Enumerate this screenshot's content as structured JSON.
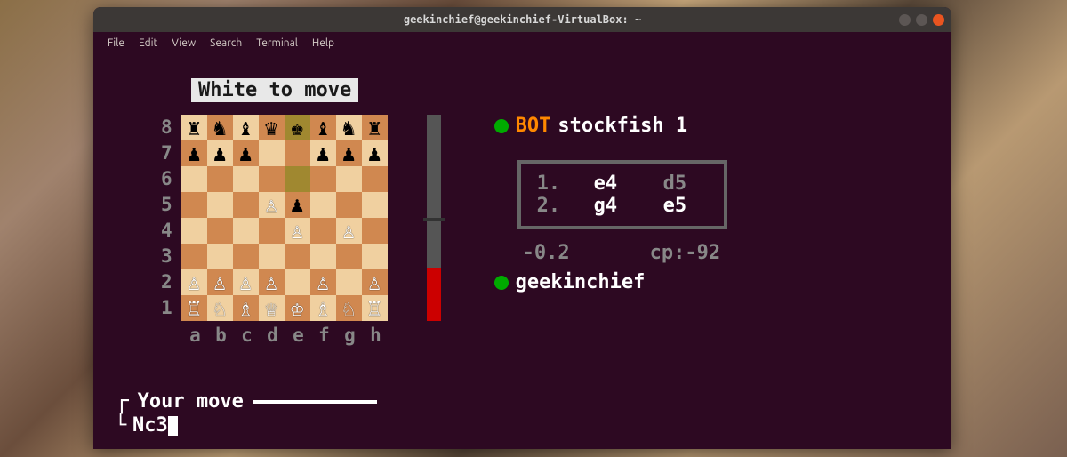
{
  "window": {
    "title": "geekinchief@geekinchief-VirtualBox: ~"
  },
  "menubar": [
    "File",
    "Edit",
    "View",
    "Search",
    "Terminal",
    "Help"
  ],
  "game": {
    "status": "White to move",
    "ranks": [
      "8",
      "7",
      "6",
      "5",
      "4",
      "3",
      "2",
      "1"
    ],
    "files": [
      "a",
      "b",
      "c",
      "d",
      "e",
      "f",
      "g",
      "h"
    ],
    "board": [
      [
        "r",
        "n",
        "b",
        "q",
        "k",
        "b",
        "n",
        "r"
      ],
      [
        "P",
        "P",
        "P",
        "",
        "",
        "P",
        "P",
        "P"
      ],
      [
        "",
        "",
        "",
        "",
        "",
        "",
        "",
        ""
      ],
      [
        "",
        "",
        "",
        "P",
        "p",
        "",
        "",
        ""
      ],
      [
        "",
        "",
        "",
        "",
        "P",
        "",
        "P",
        ""
      ],
      [
        "",
        "",
        "",
        "",
        "",
        "",
        "",
        ""
      ],
      [
        "P",
        "P",
        "P",
        "P",
        "",
        "P",
        "",
        "P"
      ],
      [
        "R",
        "N",
        "B",
        "Q",
        "K",
        "B",
        "N",
        "R"
      ]
    ],
    "row2_color": "black",
    "highlights": [
      [
        0,
        4
      ],
      [
        2,
        4
      ]
    ]
  },
  "players": {
    "top": {
      "bot_label": "BOT",
      "name": "stockfish 1"
    },
    "bottom": {
      "name": "geekinchief"
    }
  },
  "moves": [
    {
      "num": "1.",
      "white": "e4",
      "black": "d5"
    },
    {
      "num": "2.",
      "white": "g4",
      "black": "e5"
    }
  ],
  "eval": {
    "score": "-0.2",
    "cp": "cp:-92"
  },
  "input": {
    "label": "Your move",
    "value": "Nc3"
  }
}
